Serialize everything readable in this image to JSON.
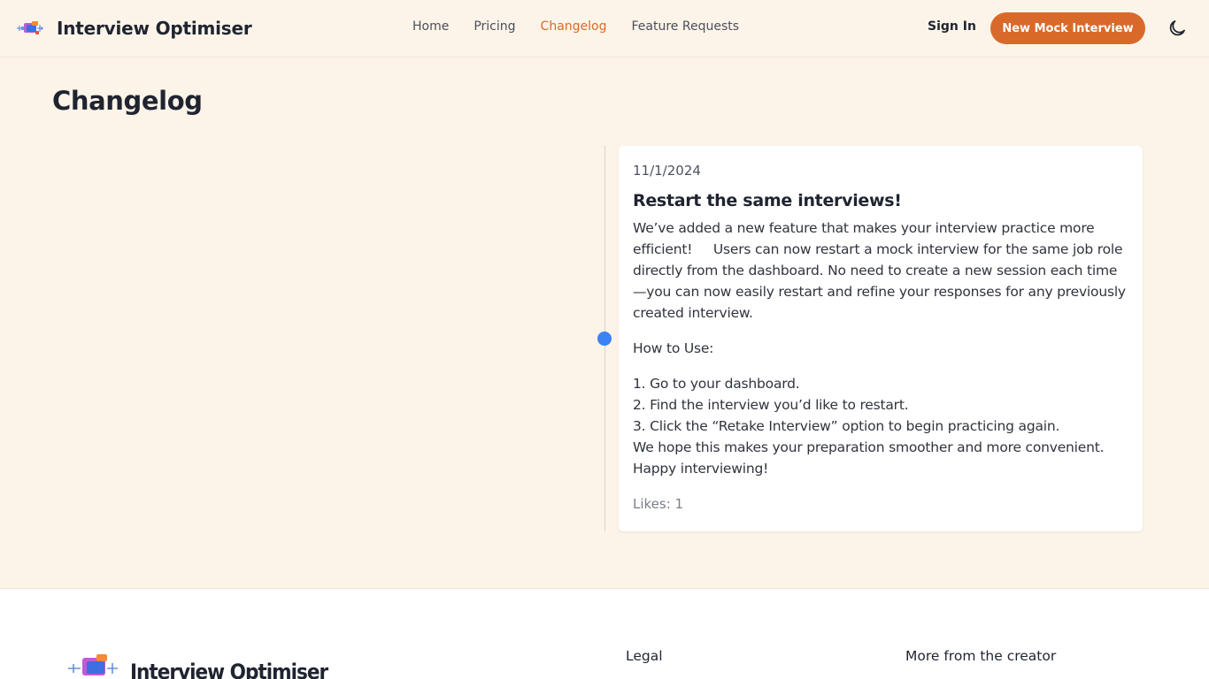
{
  "header": {
    "brand": "Interview Optimiser",
    "nav": [
      {
        "label": "Home",
        "active": false
      },
      {
        "label": "Pricing",
        "active": false
      },
      {
        "label": "Changelog",
        "active": true
      },
      {
        "label": "Feature Requests",
        "active": false
      }
    ],
    "sign_in": "Sign In",
    "cta": "New Mock Interview",
    "theme_icon": "moon-icon"
  },
  "page": {
    "title": "Changelog"
  },
  "entry": {
    "date": "11/1/2024",
    "title": "Restart the same interviews!",
    "intro": "We’ve added a new feature that makes your interview practice more efficient!     Users can now restart a mock interview for the same job role directly from the dashboard. No need to create a new session each time—you can now easily restart and refine your responses for any previously created interview.",
    "howto": "How to Use:",
    "steps": [
      "1. Go to your dashboard.",
      "2. Find the interview you’d like to restart.",
      "3. Click the “Retake Interview” option to begin practicing again."
    ],
    "closing": "We hope this makes your preparation smoother and more convenient. Happy interviewing!",
    "likes": "Likes: 1"
  },
  "footer": {
    "brand": "Interview Optimiser",
    "legal_title": "Legal",
    "more_title": "More from the creator"
  },
  "colors": {
    "background": "#fdf4e9",
    "accent": "#d9692b",
    "timeline_dot": "#3b82f6"
  }
}
